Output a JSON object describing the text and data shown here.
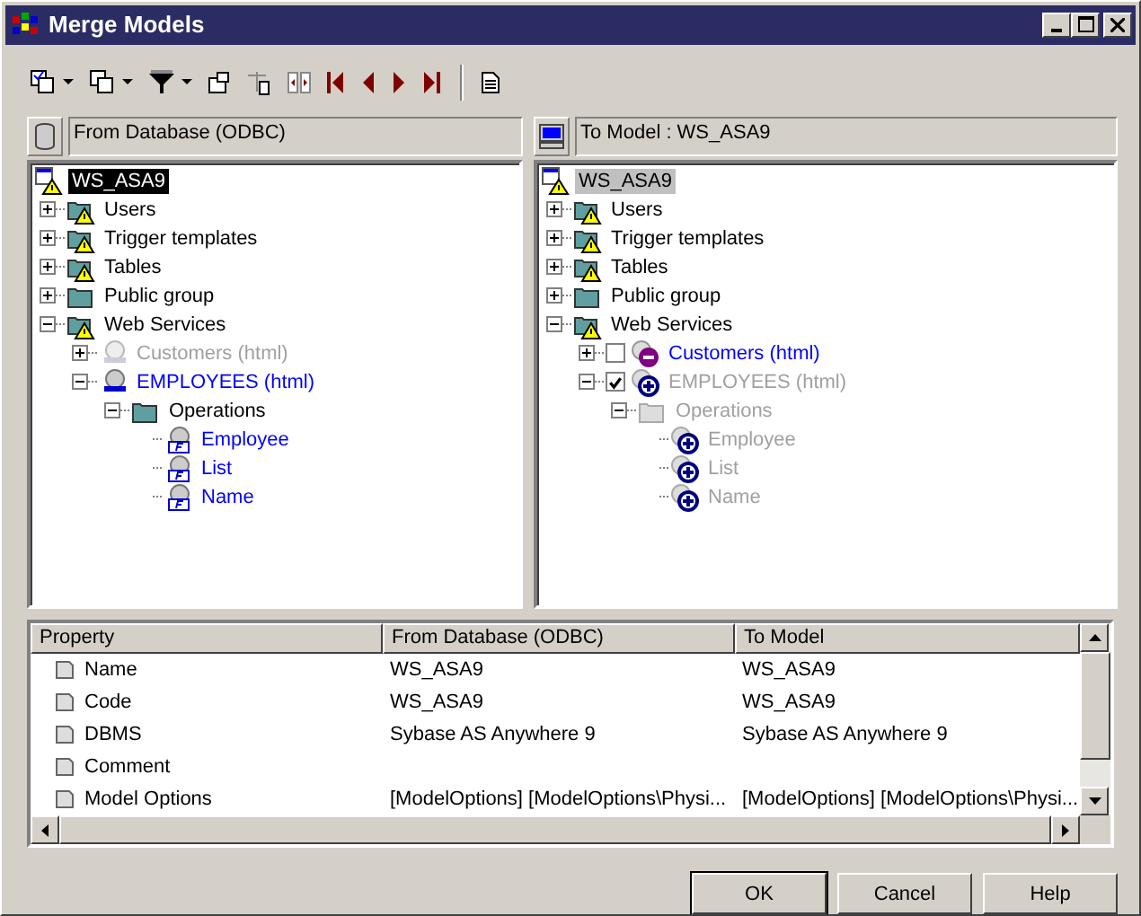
{
  "window": {
    "title": "Merge Models"
  },
  "source_pane": {
    "label": "From Database (ODBC)",
    "active": true,
    "tree": {
      "label": "WS_ASA9",
      "kind": "model",
      "selected": true,
      "children": [
        {
          "label": "Users",
          "kind": "folder_warning",
          "changed": false,
          "disabled": false,
          "expanded": false,
          "selected": false
        },
        {
          "label": "Trigger templates",
          "kind": "folder_warning",
          "changed": false,
          "disabled": false,
          "expanded": false,
          "selected": false
        },
        {
          "label": "Tables",
          "kind": "folder_warning",
          "changed": false,
          "disabled": false,
          "expanded": false,
          "selected": false
        },
        {
          "label": "Public group",
          "kind": "folder",
          "changed": false,
          "disabled": false,
          "expanded": false,
          "selected": false
        },
        {
          "label": "Web Services",
          "kind": "folder_warning",
          "changed": false,
          "disabled": false,
          "expanded": true,
          "selected": false,
          "children": [
            {
              "label": "Customers (html)",
              "kind": "service",
              "disabled": true,
              "expanded": false,
              "selected": false
            },
            {
              "label": "EMPLOYEES (html)",
              "kind": "service",
              "changed": true,
              "disabled": false,
              "expanded": true,
              "selected": false,
              "children": [
                {
                  "label": "Operations",
                  "kind": "folder",
                  "changed": false,
                  "disabled": false,
                  "expanded": true,
                  "selected": false,
                  "children": [
                    {
                      "label": "Employee",
                      "kind": "operation",
                      "changed": true,
                      "disabled": false,
                      "selected": false
                    },
                    {
                      "label": "List",
                      "kind": "operation",
                      "changed": true,
                      "disabled": false,
                      "selected": false
                    },
                    {
                      "label": "Name",
                      "kind": "operation",
                      "changed": true,
                      "disabled": false,
                      "selected": false
                    }
                  ]
                }
              ]
            }
          ]
        }
      ]
    }
  },
  "target_pane": {
    "label": "To Model : WS_ASA9",
    "active": false,
    "tree": {
      "label": "WS_ASA9",
      "kind": "model",
      "selected": true,
      "children": [
        {
          "label": "Users",
          "kind": "folder_warning",
          "changed": false,
          "disabled": false,
          "expanded": false,
          "selected": false
        },
        {
          "label": "Trigger templates",
          "kind": "folder_warning",
          "changed": false,
          "disabled": false,
          "expanded": false,
          "selected": false
        },
        {
          "label": "Tables",
          "kind": "folder_warning",
          "changed": false,
          "disabled": false,
          "expanded": false,
          "selected": false
        },
        {
          "label": "Public group",
          "kind": "folder",
          "changed": false,
          "disabled": false,
          "expanded": false,
          "selected": false
        },
        {
          "label": "Web Services",
          "kind": "folder_warning",
          "changed": false,
          "disabled": false,
          "expanded": true,
          "selected": false,
          "children": [
            {
              "label": "Customers (html)",
              "kind": "removed",
              "changed": true,
              "disabled": false,
              "expanded": false,
              "checked": false,
              "selected": false
            },
            {
              "label": "EMPLOYEES (html)",
              "kind": "added",
              "disabled": true,
              "expanded": true,
              "checked": true,
              "selected": false,
              "children": [
                {
                  "label": "Operations",
                  "kind": "folder",
                  "disabled": true,
                  "expanded": true,
                  "selected": false,
                  "children": [
                    {
                      "label": "Employee",
                      "kind": "added",
                      "disabled": true,
                      "selected": false
                    },
                    {
                      "label": "List",
                      "kind": "added",
                      "disabled": true,
                      "selected": false
                    },
                    {
                      "label": "Name",
                      "kind": "added",
                      "disabled": true,
                      "selected": false
                    }
                  ]
                }
              ]
            }
          ]
        }
      ]
    }
  },
  "properties": {
    "columns": [
      "Property",
      "From Database (ODBC)",
      "To Model"
    ],
    "rows": [
      {
        "property": "Name",
        "from": "WS_ASA9",
        "to": "WS_ASA9"
      },
      {
        "property": "Code",
        "from": "WS_ASA9",
        "to": "WS_ASA9"
      },
      {
        "property": "DBMS",
        "from": "Sybase AS Anywhere 9",
        "to": "Sybase AS Anywhere 9"
      },
      {
        "property": "Comment"
      },
      {
        "property": "Model Options",
        "from": "[ModelOptions]  [ModelOptions\\Physi...",
        "to": "[ModelOptions]  [ModelOptions\\Physi..."
      }
    ]
  },
  "buttons": [
    {
      "label": "OK",
      "default": true
    },
    {
      "label": "Cancel",
      "default": false
    },
    {
      "label": "Help",
      "default": false
    }
  ]
}
